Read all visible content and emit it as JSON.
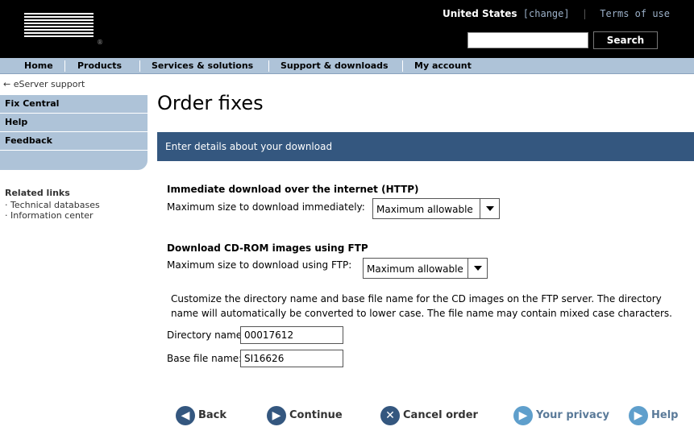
{
  "header": {
    "logo_text": "IBM",
    "logo_mark": "®",
    "country": "United States",
    "change_link": "[change]",
    "terms_link": "Terms of use",
    "search_placeholder": "",
    "search_button": "Search"
  },
  "topnav": {
    "items": [
      "Home",
      "Products",
      "Services & solutions",
      "Support & downloads",
      "My account"
    ]
  },
  "leftnav": {
    "back_link": "← eServer support",
    "items": [
      "Fix Central",
      "Help",
      "Feedback"
    ],
    "related_heading": "Related links",
    "related_links": [
      "· Technical databases",
      "· Information center"
    ]
  },
  "main": {
    "title": "Order fixes",
    "section_bar": "Enter details about your download",
    "http": {
      "heading": "Immediate download over the internet (HTTP)",
      "label": "Maximum size to download immediately:",
      "selected": "Maximum allowable"
    },
    "ftp": {
      "heading": "Download CD-ROM images using FTP",
      "label": "Maximum size to download using FTP:",
      "selected": "Maximum allowable"
    },
    "customize_text": "Customize the directory name and base file name for the CD images on the FTP server. The directory name will automatically be converted to lower case. The file name may contain mixed case characters.",
    "directory_label": "Directory name:",
    "directory_value": "00017612",
    "basefile_label": "Base file name:",
    "basefile_value": "SI16626"
  },
  "footer_buttons": {
    "back": "Back",
    "continue": "Continue",
    "cancel": "Cancel order",
    "privacy": "Your privacy",
    "help": "Help"
  },
  "colors": {
    "accent": "#34577f",
    "nav_bg": "#aec3d8",
    "masthead": "#000000"
  }
}
